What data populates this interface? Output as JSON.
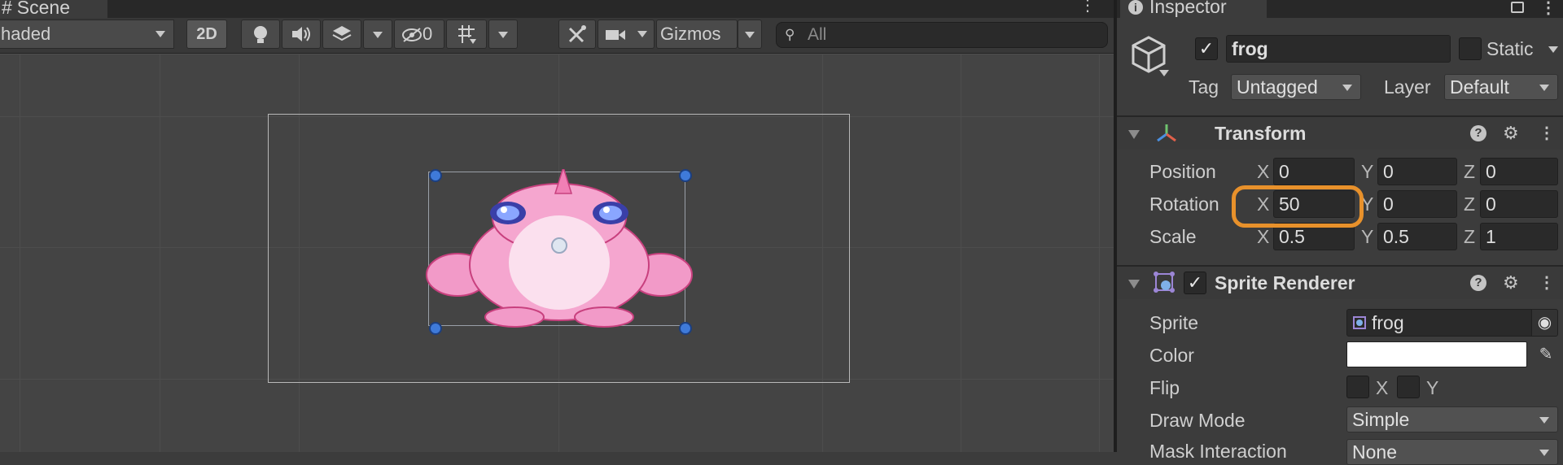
{
  "scene": {
    "tab_label": "Scene",
    "shading_mode": "haded",
    "btn_2d": "2D",
    "hidden_count": "0",
    "gizmos_label": "Gizmos",
    "search_placeholder": "All"
  },
  "inspector": {
    "tab_label": "Inspector",
    "object": {
      "name": "frog",
      "active": true,
      "static_label": "Static",
      "tag_label": "Tag",
      "tag_value": "Untagged",
      "layer_label": "Layer",
      "layer_value": "Default"
    },
    "transform": {
      "title": "Transform",
      "position_label": "Position",
      "rotation_label": "Rotation",
      "scale_label": "Scale",
      "axis_x": "X",
      "axis_y": "Y",
      "axis_z": "Z",
      "position": {
        "x": "0",
        "y": "0",
        "z": "0"
      },
      "rotation": {
        "x": "50",
        "y": "0",
        "z": "0"
      },
      "scale": {
        "x": "0.5",
        "y": "0.5",
        "z": "1"
      }
    },
    "sprite_renderer": {
      "title": "Sprite Renderer",
      "enabled": true,
      "sprite_label": "Sprite",
      "sprite_value": "frog",
      "color_label": "Color",
      "color_value": "#ffffff",
      "flip_label": "Flip",
      "flip_x": "X",
      "flip_y": "Y",
      "draw_mode_label": "Draw Mode",
      "draw_mode_value": "Simple",
      "mask_interaction_label": "Mask Interaction",
      "mask_interaction_value": "None"
    }
  },
  "colors": {
    "highlight": "#e8912b",
    "handle": "#3f7ad9",
    "frog_body": "#f29ac8"
  }
}
